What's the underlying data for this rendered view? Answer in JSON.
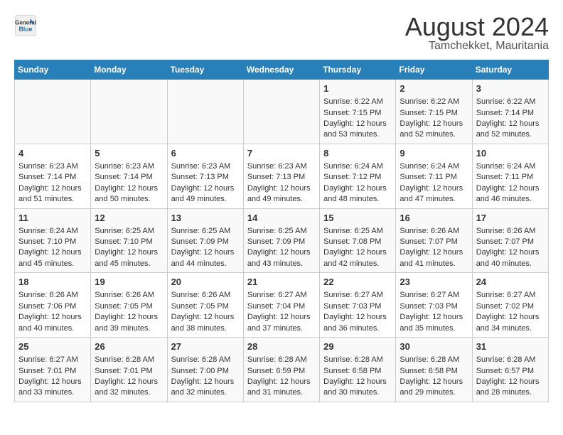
{
  "header": {
    "logo_line1": "General",
    "logo_line2": "Blue",
    "title": "August 2024",
    "subtitle": "Tamchekket, Mauritania"
  },
  "calendar": {
    "days_of_week": [
      "Sunday",
      "Monday",
      "Tuesday",
      "Wednesday",
      "Thursday",
      "Friday",
      "Saturday"
    ],
    "weeks": [
      [
        {
          "day": "",
          "info": ""
        },
        {
          "day": "",
          "info": ""
        },
        {
          "day": "",
          "info": ""
        },
        {
          "day": "",
          "info": ""
        },
        {
          "day": "1",
          "info": "Sunrise: 6:22 AM\nSunset: 7:15 PM\nDaylight: 12 hours\nand 53 minutes."
        },
        {
          "day": "2",
          "info": "Sunrise: 6:22 AM\nSunset: 7:15 PM\nDaylight: 12 hours\nand 52 minutes."
        },
        {
          "day": "3",
          "info": "Sunrise: 6:22 AM\nSunset: 7:14 PM\nDaylight: 12 hours\nand 52 minutes."
        }
      ],
      [
        {
          "day": "4",
          "info": "Sunrise: 6:23 AM\nSunset: 7:14 PM\nDaylight: 12 hours\nand 51 minutes."
        },
        {
          "day": "5",
          "info": "Sunrise: 6:23 AM\nSunset: 7:14 PM\nDaylight: 12 hours\nand 50 minutes."
        },
        {
          "day": "6",
          "info": "Sunrise: 6:23 AM\nSunset: 7:13 PM\nDaylight: 12 hours\nand 49 minutes."
        },
        {
          "day": "7",
          "info": "Sunrise: 6:23 AM\nSunset: 7:13 PM\nDaylight: 12 hours\nand 49 minutes."
        },
        {
          "day": "8",
          "info": "Sunrise: 6:24 AM\nSunset: 7:12 PM\nDaylight: 12 hours\nand 48 minutes."
        },
        {
          "day": "9",
          "info": "Sunrise: 6:24 AM\nSunset: 7:11 PM\nDaylight: 12 hours\nand 47 minutes."
        },
        {
          "day": "10",
          "info": "Sunrise: 6:24 AM\nSunset: 7:11 PM\nDaylight: 12 hours\nand 46 minutes."
        }
      ],
      [
        {
          "day": "11",
          "info": "Sunrise: 6:24 AM\nSunset: 7:10 PM\nDaylight: 12 hours\nand 45 minutes."
        },
        {
          "day": "12",
          "info": "Sunrise: 6:25 AM\nSunset: 7:10 PM\nDaylight: 12 hours\nand 45 minutes."
        },
        {
          "day": "13",
          "info": "Sunrise: 6:25 AM\nSunset: 7:09 PM\nDaylight: 12 hours\nand 44 minutes."
        },
        {
          "day": "14",
          "info": "Sunrise: 6:25 AM\nSunset: 7:09 PM\nDaylight: 12 hours\nand 43 minutes."
        },
        {
          "day": "15",
          "info": "Sunrise: 6:25 AM\nSunset: 7:08 PM\nDaylight: 12 hours\nand 42 minutes."
        },
        {
          "day": "16",
          "info": "Sunrise: 6:26 AM\nSunset: 7:07 PM\nDaylight: 12 hours\nand 41 minutes."
        },
        {
          "day": "17",
          "info": "Sunrise: 6:26 AM\nSunset: 7:07 PM\nDaylight: 12 hours\nand 40 minutes."
        }
      ],
      [
        {
          "day": "18",
          "info": "Sunrise: 6:26 AM\nSunset: 7:06 PM\nDaylight: 12 hours\nand 40 minutes."
        },
        {
          "day": "19",
          "info": "Sunrise: 6:26 AM\nSunset: 7:05 PM\nDaylight: 12 hours\nand 39 minutes."
        },
        {
          "day": "20",
          "info": "Sunrise: 6:26 AM\nSunset: 7:05 PM\nDaylight: 12 hours\nand 38 minutes."
        },
        {
          "day": "21",
          "info": "Sunrise: 6:27 AM\nSunset: 7:04 PM\nDaylight: 12 hours\nand 37 minutes."
        },
        {
          "day": "22",
          "info": "Sunrise: 6:27 AM\nSunset: 7:03 PM\nDaylight: 12 hours\nand 36 minutes."
        },
        {
          "day": "23",
          "info": "Sunrise: 6:27 AM\nSunset: 7:03 PM\nDaylight: 12 hours\nand 35 minutes."
        },
        {
          "day": "24",
          "info": "Sunrise: 6:27 AM\nSunset: 7:02 PM\nDaylight: 12 hours\nand 34 minutes."
        }
      ],
      [
        {
          "day": "25",
          "info": "Sunrise: 6:27 AM\nSunset: 7:01 PM\nDaylight: 12 hours\nand 33 minutes."
        },
        {
          "day": "26",
          "info": "Sunrise: 6:28 AM\nSunset: 7:01 PM\nDaylight: 12 hours\nand 32 minutes."
        },
        {
          "day": "27",
          "info": "Sunrise: 6:28 AM\nSunset: 7:00 PM\nDaylight: 12 hours\nand 32 minutes."
        },
        {
          "day": "28",
          "info": "Sunrise: 6:28 AM\nSunset: 6:59 PM\nDaylight: 12 hours\nand 31 minutes."
        },
        {
          "day": "29",
          "info": "Sunrise: 6:28 AM\nSunset: 6:58 PM\nDaylight: 12 hours\nand 30 minutes."
        },
        {
          "day": "30",
          "info": "Sunrise: 6:28 AM\nSunset: 6:58 PM\nDaylight: 12 hours\nand 29 minutes."
        },
        {
          "day": "31",
          "info": "Sunrise: 6:28 AM\nSunset: 6:57 PM\nDaylight: 12 hours\nand 28 minutes."
        }
      ]
    ]
  }
}
